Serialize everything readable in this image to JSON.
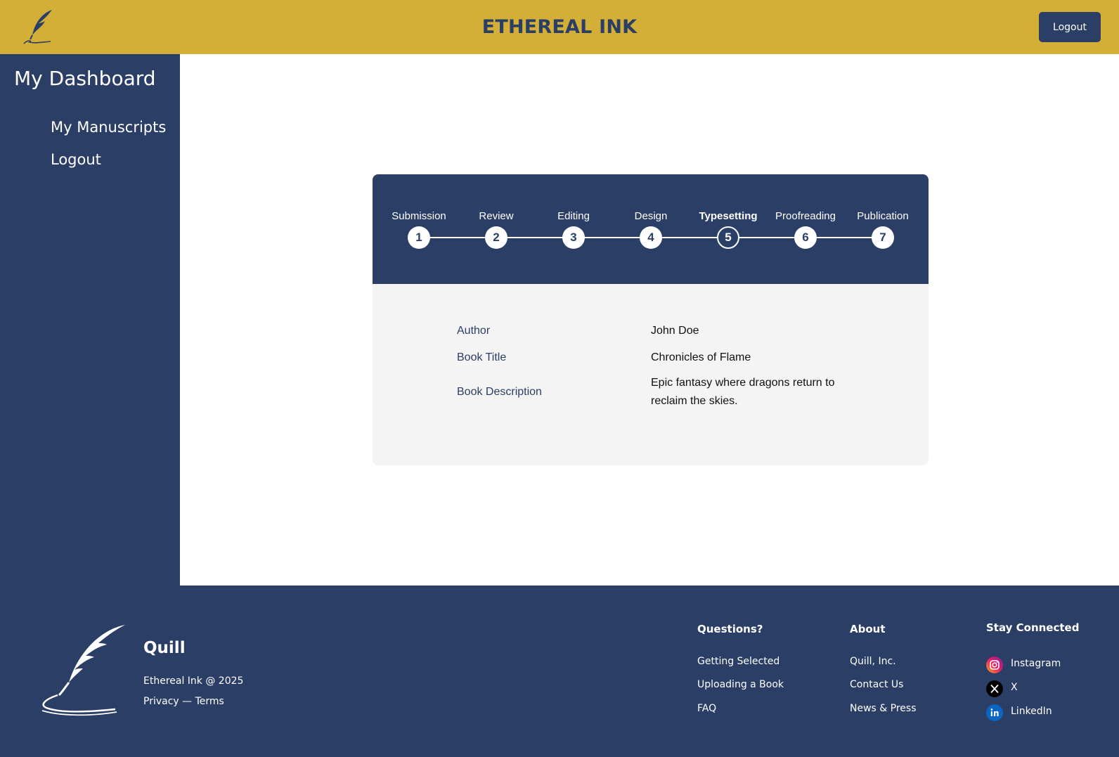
{
  "header": {
    "title": "ETHEREAL INK",
    "logout_label": "Logout",
    "logo_icon": "feather-quill-icon"
  },
  "sidebar": {
    "title": "My Dashboard",
    "items": [
      {
        "label": "My Manuscripts"
      },
      {
        "label": "Logout"
      }
    ]
  },
  "stepper": {
    "steps": [
      {
        "label": "Submission",
        "number": "1"
      },
      {
        "label": "Review",
        "number": "2"
      },
      {
        "label": "Editing",
        "number": "3"
      },
      {
        "label": "Design",
        "number": "4"
      },
      {
        "label": "Typesetting",
        "number": "5",
        "active": true
      },
      {
        "label": "Proofreading",
        "number": "6"
      },
      {
        "label": "Publication",
        "number": "7"
      }
    ]
  },
  "manuscript": {
    "author_label": "Author",
    "author_value": "John Doe",
    "title_label": "Book Title",
    "title_value": "Chronicles of Flame",
    "description_label": "Book Description",
    "description_value": "Epic fantasy where dragons return to reclaim the skies."
  },
  "footer": {
    "brand": "Quill",
    "copyright": "Ethereal Ink @ 2025",
    "legal": "Privacy — Terms",
    "questions": {
      "heading": "Questions?",
      "links": [
        "Getting Selected",
        "Uploading a Book",
        "FAQ"
      ]
    },
    "about": {
      "heading": "About",
      "links": [
        "Quill, Inc.",
        "Contact Us",
        "News & Press"
      ]
    },
    "social": {
      "heading": "Stay Connected",
      "links": [
        {
          "label": "Instagram",
          "icon": "instagram-icon"
        },
        {
          "label": "X",
          "icon": "x-icon"
        },
        {
          "label": "LinkedIn",
          "icon": "linkedin-icon"
        }
      ]
    }
  },
  "colors": {
    "header_bg": "#d4af37",
    "navy": "#2b3e66",
    "card_bg": "#f4f4f4"
  }
}
